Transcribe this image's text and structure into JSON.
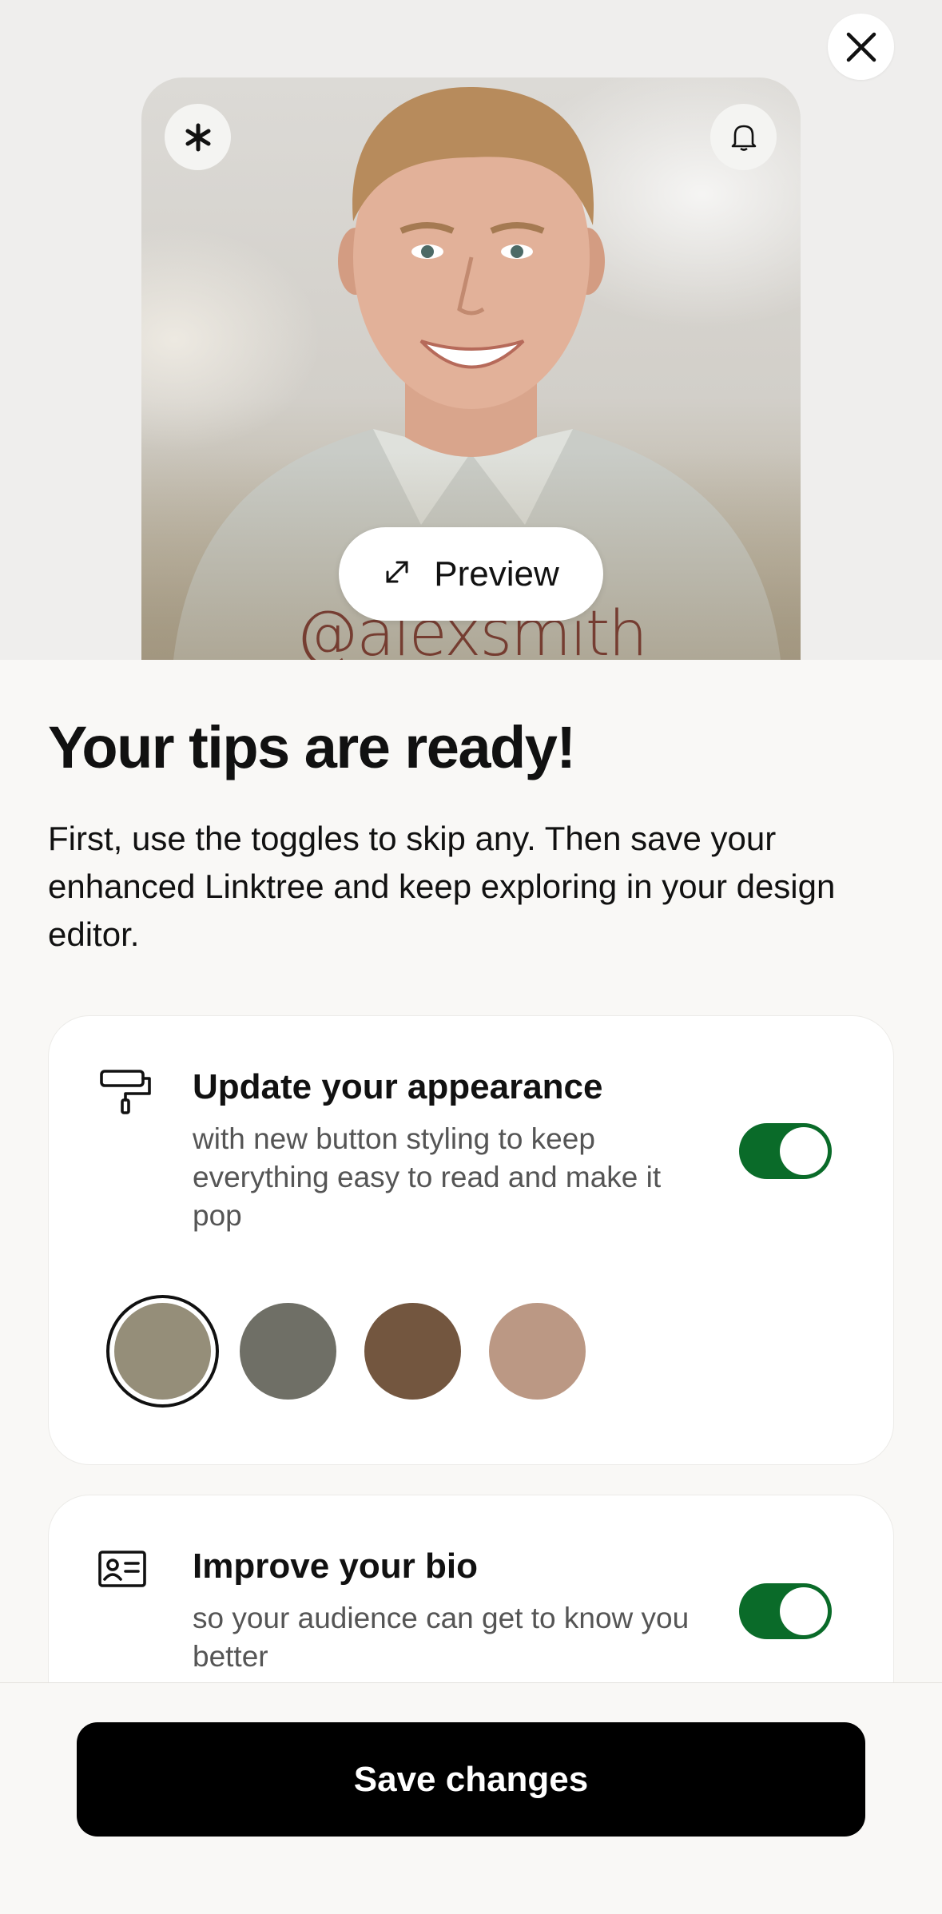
{
  "preview": {
    "handle": "@alexsmith",
    "preview_label": "Preview"
  },
  "header": {
    "title": "Your tips are ready!",
    "description": "First, use the toggles to skip any. Then save your enhanced Linktree and keep exploring in your design editor."
  },
  "tips": [
    {
      "title": "Update your appearance",
      "subtitle": "with new button styling to keep everything easy to read and make it pop",
      "icon": "paint-roller-icon",
      "enabled": true,
      "swatches": [
        "#958e79",
        "#6f6f66",
        "#73563f",
        "#bb9884"
      ],
      "selected_swatch": 0
    },
    {
      "title": "Improve your bio",
      "subtitle": "so your audience can get to know you better",
      "icon": "id-card-icon",
      "enabled": true
    }
  ],
  "footer": {
    "save_label": "Save changes"
  },
  "colors": {
    "toggle_on": "#0a6b29",
    "primary_button": "#000000",
    "background": "#f9f8f6"
  }
}
